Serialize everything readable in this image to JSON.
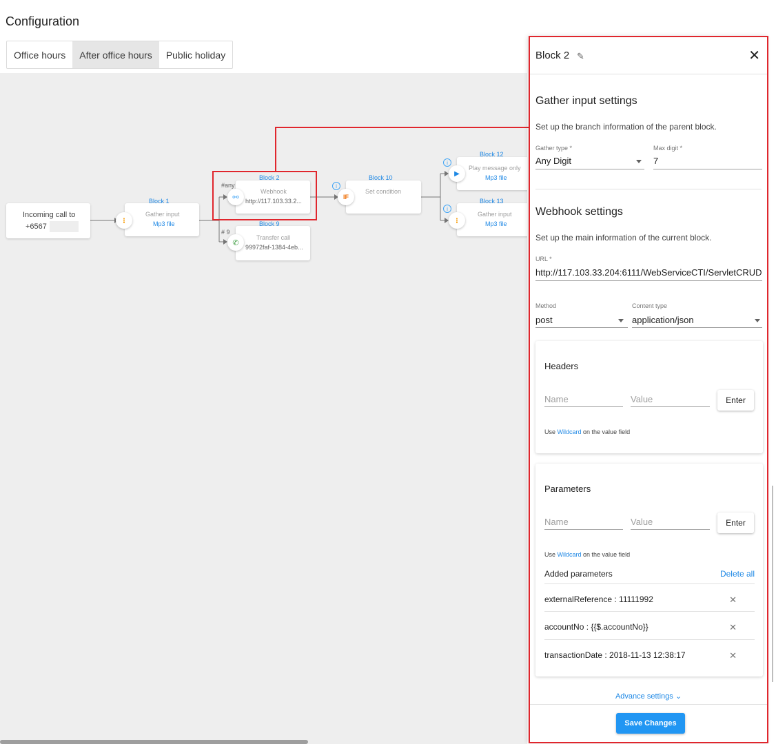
{
  "page": {
    "title": "Configuration"
  },
  "tabs": [
    {
      "label": "Office hours",
      "active": false
    },
    {
      "label": "After office hours",
      "active": true
    },
    {
      "label": "Public holiday",
      "active": false
    }
  ],
  "flow": {
    "incoming": {
      "label": "Incoming call to",
      "number": "+6567"
    },
    "block1": {
      "title": "Block 1",
      "type": "Gather input",
      "file": "Mp3 file"
    },
    "block2": {
      "title": "Block 2",
      "type": "Webhook",
      "detail": "http://117.103.33.2...",
      "edge_label": "#any"
    },
    "block9": {
      "title": "Block 9",
      "type": "Transfer call",
      "detail": "99972faf-1384-4eb...",
      "edge_label": "# 9"
    },
    "block10": {
      "title": "Block 10",
      "type": "Set condition",
      "icon_text": "IF"
    },
    "block12": {
      "title": "Block 12",
      "type": "Play message only",
      "file": "Mp3 file"
    },
    "block13": {
      "title": "Block 13",
      "type": "Gather input",
      "file": "Mp3 file"
    }
  },
  "panel": {
    "title": "Block 2",
    "gather": {
      "title": "Gather input settings",
      "desc": "Set up the branch information of the parent block.",
      "type_label": "Gather type *",
      "type_value": "Any Digit",
      "max_label": "Max digit *",
      "max_value": "7"
    },
    "webhook": {
      "title": "Webhook settings",
      "desc": "Set up the main information of the current block.",
      "url_label": "URL *",
      "url_value": "http://117.103.33.204:6111/WebServiceCTI/ServletCRUD",
      "method_label": "Method",
      "method_value": "post",
      "content_label": "Content type",
      "content_value": "application/json"
    },
    "headers": {
      "title": "Headers",
      "name_ph": "Name",
      "value_ph": "Value",
      "enter": "Enter",
      "hint_prefix": "Use ",
      "hint_link": "Wildcard",
      "hint_suffix": " on the value field"
    },
    "parameters": {
      "title": "Parameters",
      "name_ph": "Name",
      "value_ph": "Value",
      "enter": "Enter",
      "hint_prefix": "Use ",
      "hint_link": "Wildcard",
      "hint_suffix": " on the value field",
      "added_title": "Added parameters",
      "delete_all": "Delete all",
      "items": [
        "externalReference : 11111992",
        "accountNo : {{$.accountNo}}",
        "transactionDate : 2018-11-13 12:38:17"
      ]
    },
    "advance": "Advance settings",
    "save": "Save Changes"
  },
  "colors": {
    "accent": "#2196f3",
    "link": "#1e88e5",
    "highlight": "#e0262d",
    "canvas": "#eeeeee"
  }
}
